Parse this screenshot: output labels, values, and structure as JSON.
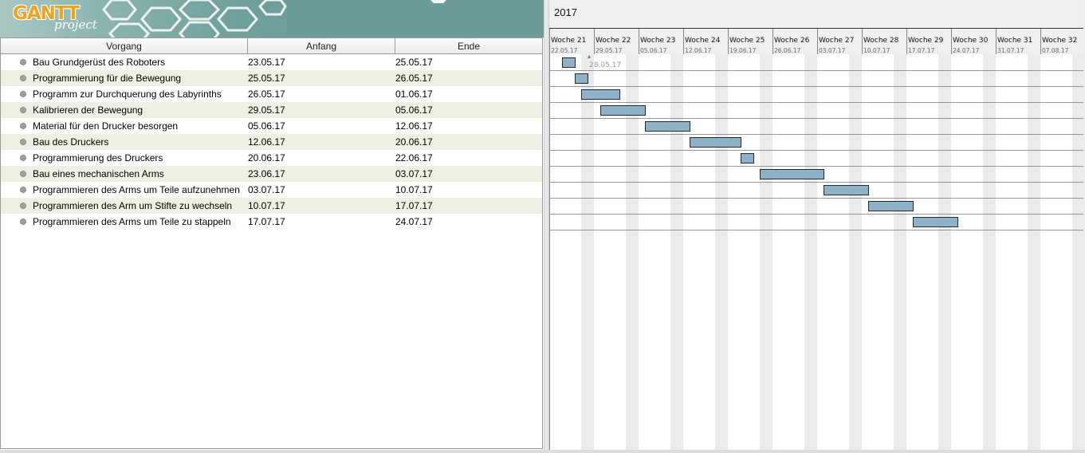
{
  "logo": {
    "word": "GANTT",
    "sub": "project"
  },
  "table": {
    "headers": {
      "name": "Vorgang",
      "start": "Anfang",
      "end": "Ende"
    },
    "tasks": [
      {
        "name": "Bau Grundgerüst des Roboters",
        "start": "23.05.17",
        "end": "25.05.17"
      },
      {
        "name": "Programmierung für die Bewegung",
        "start": "25.05.17",
        "end": "26.05.17"
      },
      {
        "name": "Programm zur Durchquerung des Labyrinths",
        "start": "26.05.17",
        "end": "01.06.17"
      },
      {
        "name": "Kalibrieren der Bewegung",
        "start": "29.05.17",
        "end": "05.06.17"
      },
      {
        "name": "Material für den Drucker besorgen",
        "start": "05.06.17",
        "end": "12.06.17"
      },
      {
        "name": "Bau des Druckers",
        "start": "12.06.17",
        "end": "20.06.17"
      },
      {
        "name": "Programmierung des Druckers",
        "start": "20.06.17",
        "end": "22.06.17"
      },
      {
        "name": "Bau eines mechanischen Arms",
        "start": "23.06.17",
        "end": "03.07.17"
      },
      {
        "name": "Programmieren des Arms um Teile aufzunehmen",
        "start": "03.07.17",
        "end": "10.07.17"
      },
      {
        "name": "Programmieren des Arm um Stifte zu wechseln",
        "start": "10.07.17",
        "end": "17.07.17"
      },
      {
        "name": "Programmieren des Arms um Teile zu stappeln",
        "start": "17.07.17",
        "end": "24.07.17"
      }
    ]
  },
  "chart": {
    "year": "2017",
    "first_day": "22.05.17",
    "weeks": [
      {
        "label": "Woche 21",
        "date": "22.05.17"
      },
      {
        "label": "Woche 22",
        "date": "29.05.17"
      },
      {
        "label": "Woche 23",
        "date": "05.06.17"
      },
      {
        "label": "Woche 24",
        "date": "12.06.17"
      },
      {
        "label": "Woche 25",
        "date": "19.06.17"
      },
      {
        "label": "Woche 26",
        "date": "26.06.17"
      },
      {
        "label": "Woche 27",
        "date": "03.07.17"
      },
      {
        "label": "Woche 28",
        "date": "10.07.17"
      },
      {
        "label": "Woche 29",
        "date": "17.07.17"
      },
      {
        "label": "Woche 30",
        "date": "24.07.17"
      },
      {
        "label": "Woche 31",
        "date": "31.07.17"
      },
      {
        "label": "Woche 32",
        "date": "07.08.17"
      }
    ],
    "marker_label": "28.05.17",
    "colors": {
      "bar_fill": "#8fb1c7",
      "bar_stroke": "#1e2d38",
      "weekend": "#ebebeb",
      "grid": "#999999"
    }
  }
}
